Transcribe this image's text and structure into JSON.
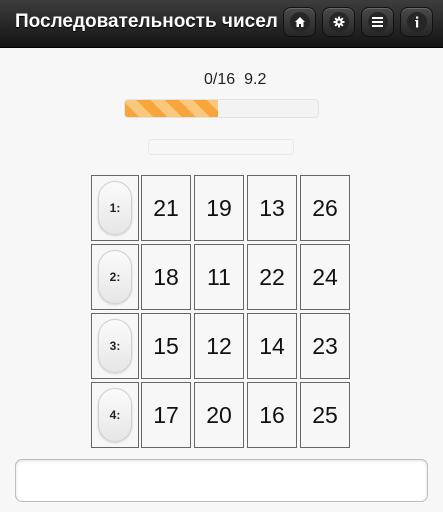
{
  "header": {
    "title": "Последовательность чисел",
    "buttons": [
      {
        "icon": "home-icon"
      },
      {
        "icon": "gear-icon"
      },
      {
        "icon": "menu-icon"
      },
      {
        "icon": "info-icon"
      }
    ]
  },
  "status": {
    "progress_text": "0/16",
    "time": "9.2",
    "timer_fraction": 0.48,
    "timer_color": "#f8a53c"
  },
  "message": "",
  "rows": [
    {
      "label": "1:",
      "numbers": [
        "21",
        "19",
        "13",
        "26"
      ]
    },
    {
      "label": "2:",
      "numbers": [
        "18",
        "11",
        "22",
        "24"
      ]
    },
    {
      "label": "3:",
      "numbers": [
        "15",
        "12",
        "14",
        "23"
      ]
    },
    {
      "label": "4:",
      "numbers": [
        "17",
        "20",
        "16",
        "25"
      ]
    }
  ],
  "answer": {
    "value": "",
    "placeholder": ""
  }
}
